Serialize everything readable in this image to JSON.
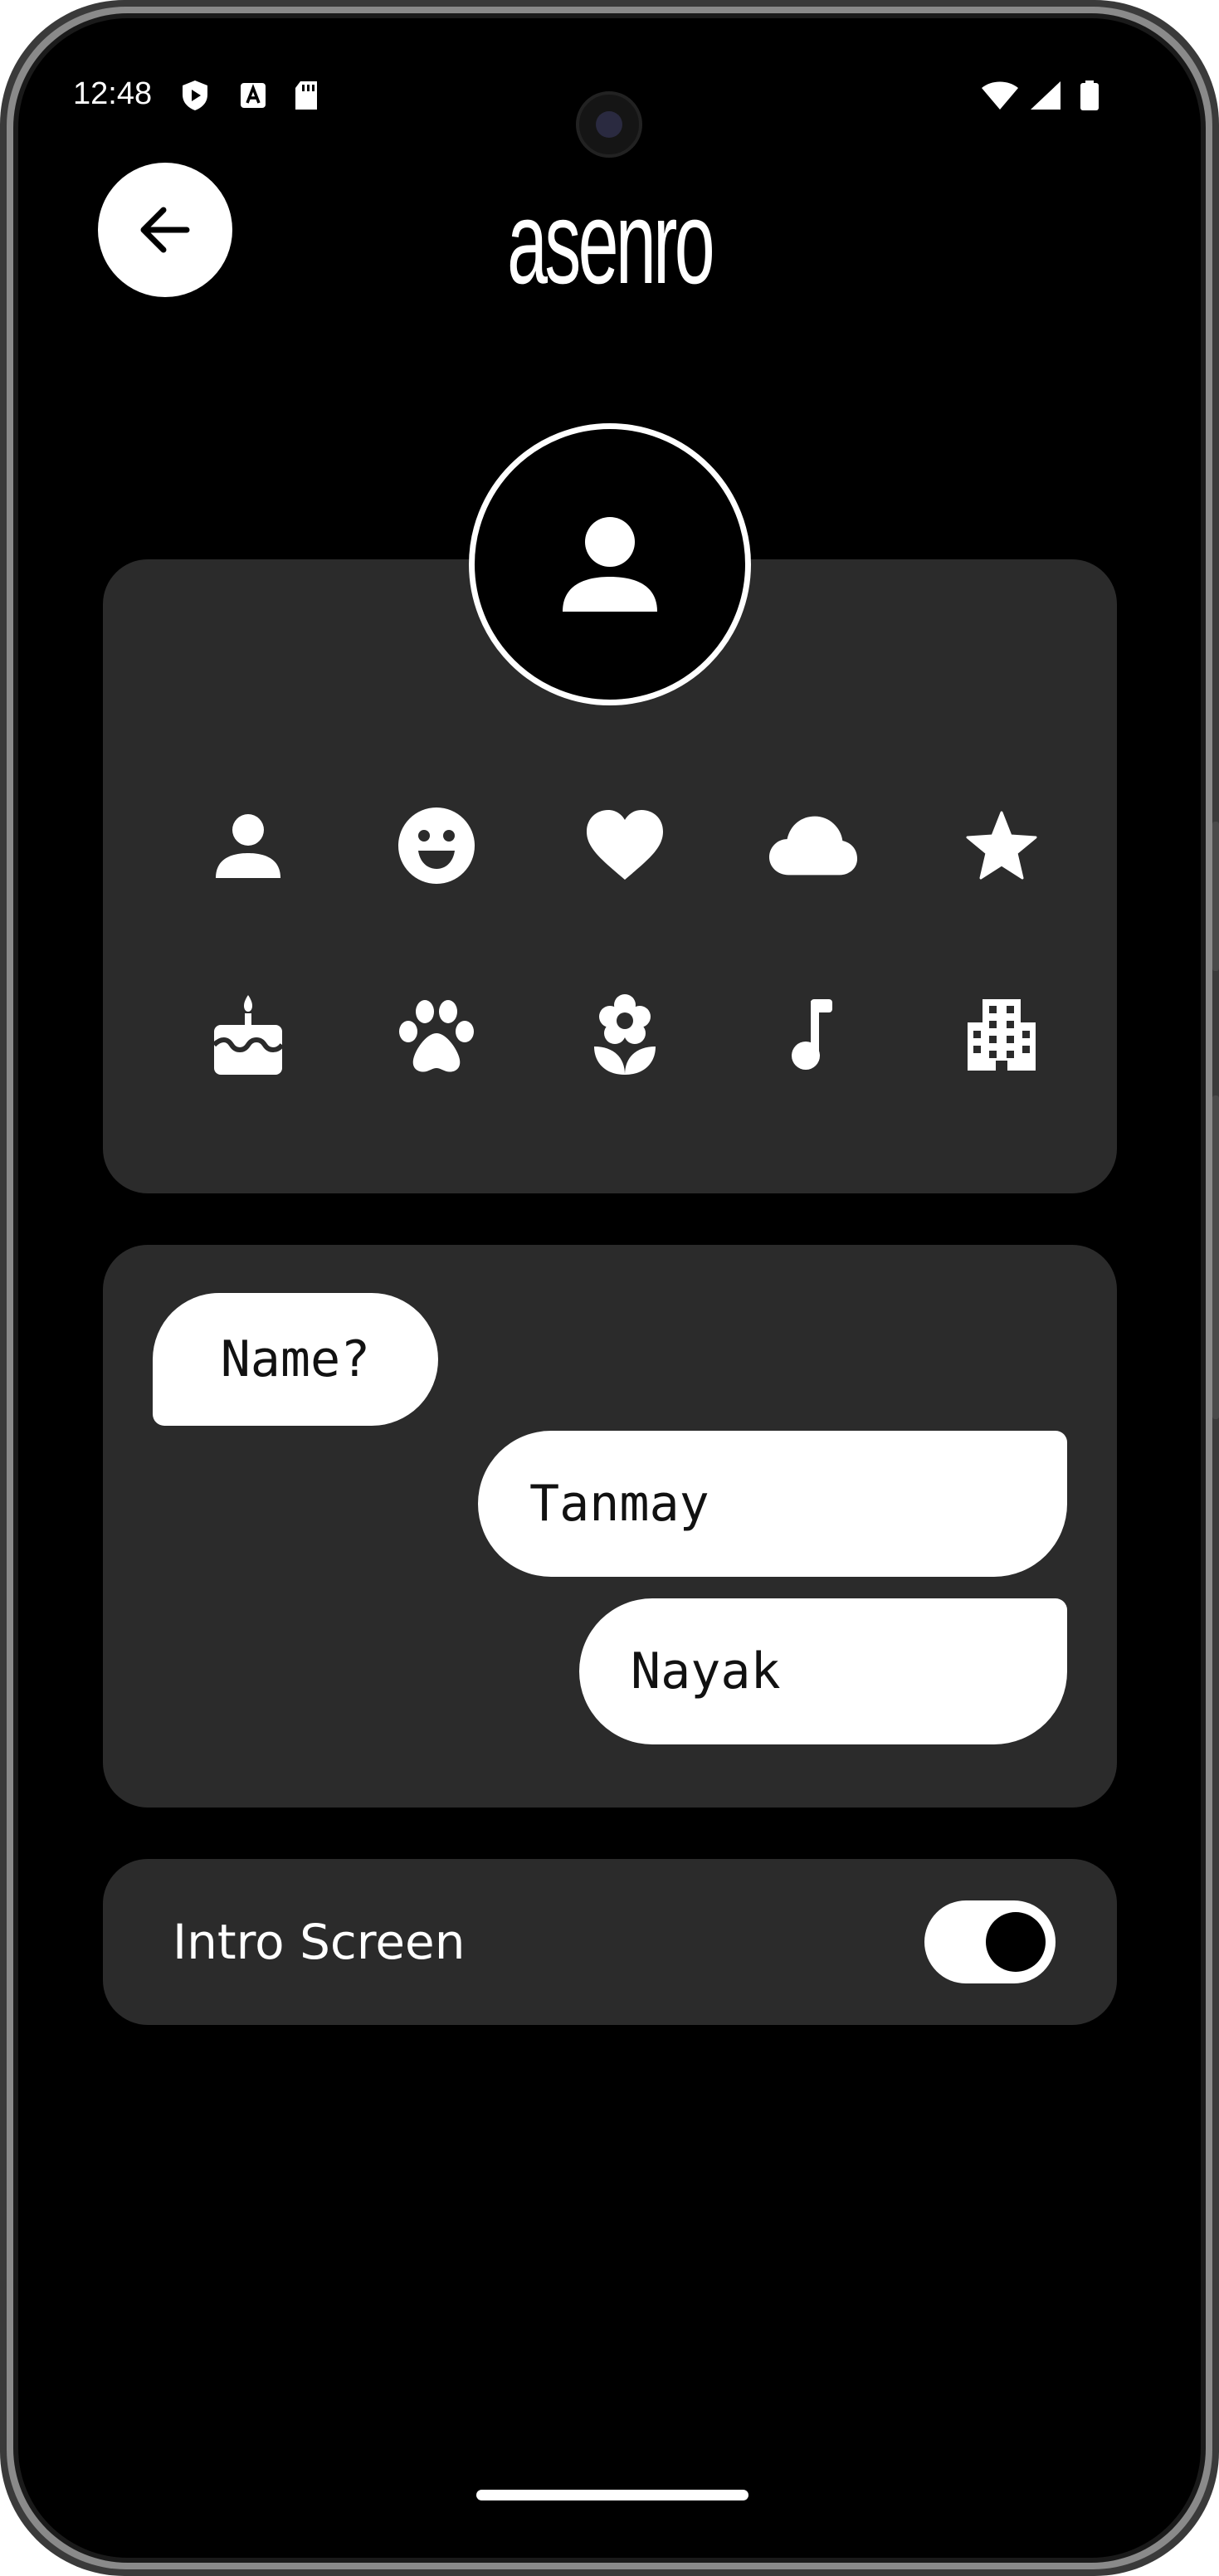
{
  "status_bar": {
    "time": "12:48",
    "left_icons": [
      "shield-play-icon",
      "text-a-icon",
      "sd-card-icon"
    ],
    "right_icons": [
      "wifi-icon",
      "cell-signal-icon",
      "battery-icon"
    ]
  },
  "header": {
    "back_icon": "arrow-left-icon",
    "title": "asenro"
  },
  "avatar": {
    "selected_icon": "person-icon"
  },
  "icon_picker": {
    "icons": [
      "person-icon",
      "smiley-icon",
      "heart-icon",
      "cloud-icon",
      "star-icon",
      "cake-icon",
      "paw-icon",
      "flower-icon",
      "music-note-icon",
      "building-icon"
    ]
  },
  "name_chat": {
    "question": "Name?",
    "first_name": "Tanmay",
    "last_name": "Nayak"
  },
  "settings": {
    "intro_screen_label": "Intro Screen",
    "intro_screen_enabled": true
  },
  "colors": {
    "background": "#000000",
    "card": "#2b2b2b",
    "foreground": "#ffffff"
  }
}
